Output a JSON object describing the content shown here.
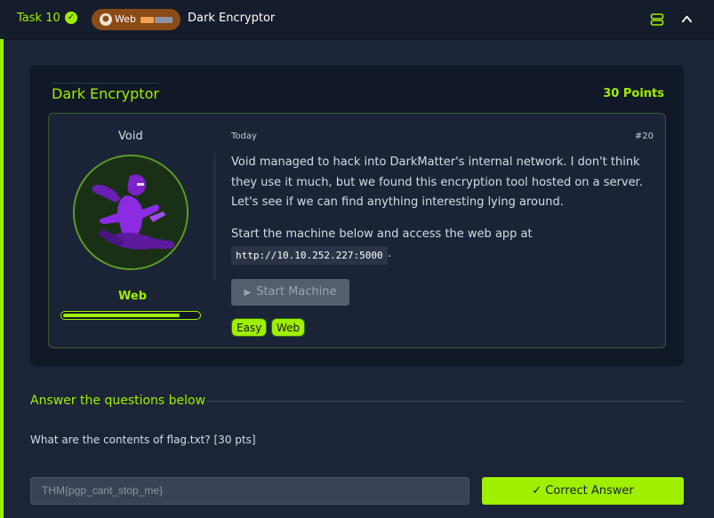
{
  "header": {
    "task_label": "Task 10",
    "category_pill": {
      "label": "Web",
      "colors": {
        "pill": "#8a4b16",
        "segment_active": "#f2a24c",
        "segment_inactive": "#8c94a2"
      }
    },
    "title": "Dark Encryptor",
    "icons": [
      "check-circle-icon",
      "hexagon-icon",
      "stack-icon",
      "chevron-up-icon"
    ]
  },
  "room": {
    "title": "Dark Encryptor",
    "points": "30 Points",
    "author": "Void",
    "category": "Web",
    "progress": 0.85,
    "date": "Today",
    "issue_number": "#20",
    "description": "Void managed to hack into  DarkMatter's internal network. I don't think they use it much, but we found this encryption tool hosted on a server. Let's see if we can find anything interesting lying around.",
    "instruction": "Start the machine below and access the web app at",
    "url": "http://10.10.252.227:5000",
    "url_suffix": ".",
    "start_button": "Start Machine",
    "tags": [
      "Easy",
      "Web"
    ]
  },
  "answers": {
    "heading": "Answer the questions below",
    "question": "What are the contents of flag.txt? [30 pts]",
    "answer_value": "THM{pgp_cant_stop_me}",
    "submit_label": "Correct Answer"
  },
  "colors": {
    "accent": "#9fef00",
    "background": "#1c2538",
    "card": "#111827"
  }
}
